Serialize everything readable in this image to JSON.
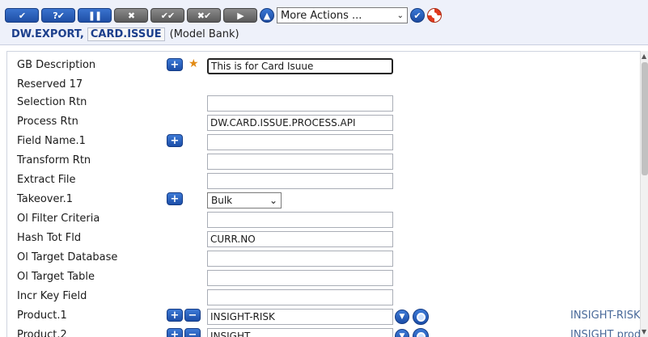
{
  "toolbar": {
    "buttons": [
      {
        "name": "commit",
        "glyph": "✔"
      },
      {
        "name": "validate",
        "glyph": "?✔"
      },
      {
        "name": "hold",
        "glyph": "❚❚"
      },
      {
        "name": "delete",
        "glyph": "✖"
      },
      {
        "name": "authorise",
        "glyph": "✔✔"
      },
      {
        "name": "reverse",
        "glyph": "✖✔"
      },
      {
        "name": "next",
        "glyph": "▶"
      }
    ],
    "actions_select": "More Actions ...",
    "up_icon": "up-arrow-icon",
    "go_icon": "check-circle-icon",
    "help_icon": "lifebuoy-icon"
  },
  "breadcrumb": {
    "app": "DW.EXPORT,",
    "record_id": "CARD.ISSUE",
    "company": "(Model Bank)"
  },
  "fields": [
    {
      "label": "GB Description",
      "value": "This is for Card Isuue",
      "plus": true,
      "required": true
    },
    {
      "label": "Reserved 17"
    },
    {
      "label": "Selection Rtn",
      "value": ""
    },
    {
      "label": "Process Rtn",
      "value": "DW.CARD.ISSUE.PROCESS.API"
    },
    {
      "label": "Field Name.1",
      "value": "",
      "plus": true
    },
    {
      "label": "Transform Rtn",
      "value": ""
    },
    {
      "label": "Extract File",
      "value": ""
    },
    {
      "label": "Takeover.1",
      "select": "Bulk",
      "plus": true
    },
    {
      "label": "Ol Filter Criteria",
      "value": ""
    },
    {
      "label": "Hash Tot Fld",
      "value": "CURR.NO"
    },
    {
      "label": "Ol Target Database",
      "value": ""
    },
    {
      "label": "Ol Target Table",
      "value": ""
    },
    {
      "label": "Incr Key Field",
      "value": ""
    },
    {
      "label": "Product.1",
      "value": "INSIGHT-RISK",
      "plus": true,
      "minus": true,
      "lookup": true,
      "enrichment": "INSIGHT-RISK p"
    },
    {
      "label": "Product.2",
      "value": "INSIGHT",
      "plus": true,
      "minus": true,
      "lookup": true,
      "enrichment": "INSIGHT produ"
    }
  ]
}
